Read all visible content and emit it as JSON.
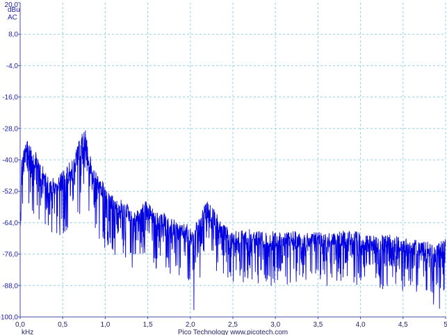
{
  "chart_data": {
    "type": "line",
    "xlabel": "kHz",
    "ylabel_unit": "dBu",
    "ylabel_mode": "AC",
    "footer": "Pico Technology   www.picotech.com",
    "xlim": [
      0,
      5
    ],
    "ylim": [
      -100,
      20
    ],
    "grid": true,
    "grid_style": "dashed",
    "x_ticks": [
      0.0,
      0.5,
      1.0,
      1.5,
      2.0,
      2.5,
      3.0,
      3.5,
      4.0,
      4.5,
      5.0
    ],
    "x_tick_labels": [
      "0,0",
      "0,5",
      "1,0",
      "1,5",
      "2,0",
      "2,5",
      "3,0",
      "3,5",
      "4,0",
      "4,5",
      "5"
    ],
    "y_ticks": [
      20,
      8,
      -4,
      -16,
      -28,
      -40,
      -52,
      -64,
      -76,
      -88,
      -100
    ],
    "y_tick_labels": [
      "20,0",
      "8,0",
      "-4,0",
      "-16,0",
      "-28,0",
      "-40,0",
      "-52,0",
      "-64,0",
      "-76,0",
      "-88,0",
      "-100,0"
    ],
    "colors": {
      "series": "#0000e0",
      "grid": "#8fd0e6",
      "axis": "#4a4aa0",
      "labels": "#1a1aa6"
    },
    "series": [
      {
        "x": [
          0.0,
          0.02,
          0.05,
          0.08,
          0.12,
          0.16,
          0.2,
          0.25,
          0.3,
          0.35,
          0.4,
          0.45,
          0.5,
          0.55,
          0.6,
          0.65,
          0.7,
          0.74,
          0.76,
          0.78,
          0.82,
          0.86,
          0.9,
          0.95,
          1.0,
          1.05,
          1.1,
          1.15,
          1.2,
          1.25,
          1.3,
          1.35,
          1.4,
          1.45,
          1.5,
          1.55,
          1.6,
          1.65,
          1.7,
          1.75,
          1.8,
          1.85,
          1.9,
          1.95,
          2.0,
          2.05,
          2.1,
          2.15,
          2.2,
          2.25,
          2.3,
          2.35,
          2.4,
          2.45,
          2.5,
          2.6,
          2.7,
          2.8,
          2.9,
          3.0,
          3.1,
          3.2,
          3.3,
          3.4,
          3.5,
          3.6,
          3.7,
          3.8,
          3.9,
          4.0,
          4.1,
          4.2,
          4.3,
          4.4,
          4.5,
          4.6,
          4.7,
          4.8,
          4.9,
          5.0
        ],
        "y": [
          -64,
          -38,
          -34,
          -33,
          -32,
          -35,
          -37,
          -41,
          -45,
          -47,
          -46,
          -46,
          -44,
          -42,
          -40,
          -37,
          -32,
          -29,
          -28,
          -30,
          -38,
          -43,
          -45,
          -47,
          -50,
          -53,
          -54,
          -56,
          -55,
          -56,
          -59,
          -60,
          -58,
          -55,
          -56,
          -58,
          -60,
          -61,
          -60,
          -63,
          -62,
          -64,
          -65,
          -64,
          -66,
          -65,
          -62,
          -58,
          -56,
          -57,
          -60,
          -63,
          -65,
          -66,
          -67,
          -67,
          -66,
          -67,
          -68,
          -67,
          -68,
          -67,
          -68,
          -68,
          -67,
          -68,
          -68,
          -67,
          -67,
          -68,
          -69,
          -69,
          -68,
          -69,
          -70,
          -70,
          -71,
          -71,
          -72,
          -70
        ],
        "floor": [
          -79,
          -60,
          -62,
          -68,
          -58,
          -64,
          -62,
          -66,
          -68,
          -72,
          -68,
          -70,
          -70,
          -67,
          -72,
          -66,
          -62,
          -56,
          -54,
          -58,
          -64,
          -72,
          -70,
          -72,
          -76,
          -74,
          -75,
          -80,
          -76,
          -78,
          -82,
          -80,
          -79,
          -76,
          -78,
          -81,
          -82,
          -84,
          -80,
          -85,
          -84,
          -85,
          -86,
          -86,
          -90,
          -99,
          -86,
          -82,
          -78,
          -80,
          -82,
          -84,
          -86,
          -86,
          -87,
          -88,
          -86,
          -88,
          -89,
          -87,
          -88,
          -87,
          -88,
          -89,
          -88,
          -89,
          -88,
          -88,
          -87,
          -89,
          -90,
          -90,
          -89,
          -89,
          -91,
          -90,
          -91,
          -92,
          -100,
          -90
        ]
      }
    ]
  }
}
